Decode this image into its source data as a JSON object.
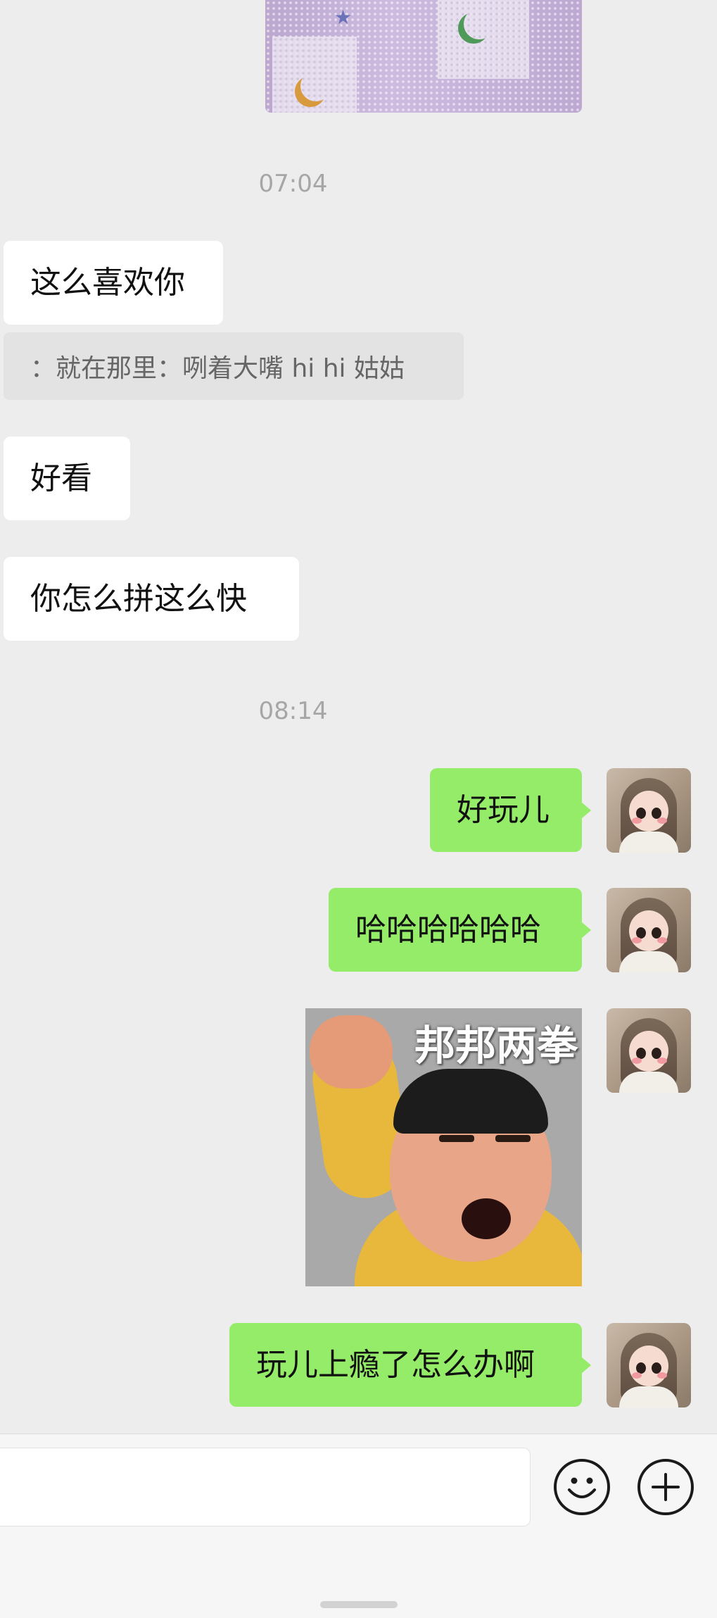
{
  "timestamps": {
    "t1": "07:04",
    "t2": "08:14"
  },
  "incoming": {
    "msg1": "这么喜欢你",
    "quote": "：就在那里：咧着大嘴 hi  hi 姑姑",
    "msg2": "好看",
    "msg3": "你怎么拼这么快"
  },
  "outgoing": {
    "msg1": "好玩儿",
    "msg2": "哈哈哈哈哈哈",
    "sticker_caption": "邦邦两拳",
    "msg3": "玩儿上瘾了怎么办啊"
  },
  "colors": {
    "background": "#ededed",
    "outgoing_bubble": "#95ec69",
    "incoming_bubble": "#ffffff",
    "timestamp_text": "#a6a6a6"
  },
  "icons": {
    "emoji": "smiley-face-icon",
    "more": "plus-icon"
  }
}
